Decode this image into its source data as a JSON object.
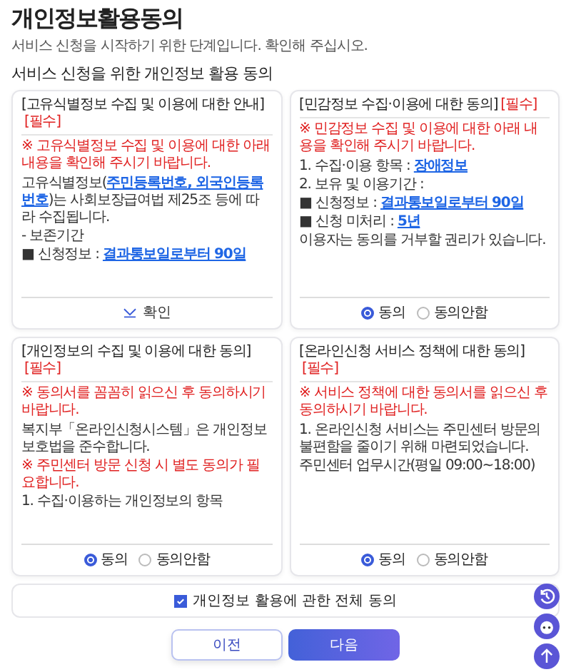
{
  "page": {
    "title": "개인정보활용동의",
    "subtitle": "서비스 신청을 시작하기 위한 단계입니다. 확인해 주십시오."
  },
  "section": {
    "heading": "서비스 신청을 위한 개인정보 활용 동의"
  },
  "cards": [
    {
      "title": "[고유식별정보 수집 및 이용에 대한 안내]",
      "required": "[필수]",
      "notice": "※ 고유식별정보 수집 및 이용에 대한 아래 내용을 확인해 주시기 바랍니다.",
      "lines": [
        {
          "kind": "text",
          "text": "고유식별정보(**주민등록번호, 외국인등록번호**)는 사회보장급여법 제25조 등에 따라 수집됩니다."
        },
        {
          "kind": "text",
          "text": "- 보존기간"
        },
        {
          "kind": "text",
          "text": "■ 신청정보 : **결과통보일로부터 90일**"
        }
      ],
      "footer": {
        "kind": "confirm",
        "label": "확인"
      }
    },
    {
      "title": "[민감정보 수집·이용에 대한 동의]",
      "required": "[필수]",
      "notice": "※ 민감정보 수집 및 이용에 대한 아래 내용을 확인해 주시기 바랍니다.",
      "lines": [
        {
          "kind": "text",
          "text": "1. 수집·이용 항목 : **장애정보**"
        },
        {
          "kind": "text",
          "text": "2. 보유 및 이용기간 :"
        },
        {
          "kind": "text",
          "text": "■ 신청정보 : **결과통보일로부터 90일**"
        },
        {
          "kind": "text",
          "text": "■ 신청 미처리 : **5년**"
        },
        {
          "kind": "text",
          "text": "이용자는 동의를 거부할 권리가 있습니다."
        }
      ],
      "footer": {
        "kind": "radio",
        "options": [
          {
            "label": "동의",
            "selected": true
          },
          {
            "label": "동의안함",
            "selected": false
          }
        ]
      }
    },
    {
      "title": "[개인정보의 수집 및 이용에 대한 동의]",
      "required": "[필수]",
      "notice": "※ 동의서를 꼼꼼히 읽으신 후 동의하시기 바랍니다.",
      "lines": [
        {
          "kind": "text",
          "text": "복지부「온라인신청시스템」은 개인정보보호법을 준수합니다."
        },
        {
          "kind": "warning",
          "text": "※ 주민센터 방문 신청 시 별도 동의가 필요합니다."
        },
        {
          "kind": "text",
          "text": "1. 수집·이용하는 개인정보의 항목"
        }
      ],
      "footer": {
        "kind": "radio",
        "options": [
          {
            "label": "동의",
            "selected": true
          },
          {
            "label": "동의안함",
            "selected": false
          }
        ]
      }
    },
    {
      "title": "[온라인신청 서비스 정책에 대한 동의]",
      "required": "[필수]",
      "notice": "※ 서비스 정책에 대한 동의서를 읽으신 후 동의하시기 바랍니다.",
      "lines": [
        {
          "kind": "text",
          "text": "1. 온라인신청 서비스는 주민센터 방문의 불편함을 줄이기 위해 마련되었습니다."
        },
        {
          "kind": "text",
          "text": "주민센터 업무시간(평일 09:00~18:00)"
        }
      ],
      "footer": {
        "kind": "radio",
        "options": [
          {
            "label": "동의",
            "selected": true
          },
          {
            "label": "동의안함",
            "selected": false
          }
        ]
      }
    }
  ],
  "all_agree": {
    "label": "개인정보 활용에 관한 전체 동의",
    "checked": true
  },
  "buttons": [
    {
      "label": "이전",
      "kind": "secondary"
    },
    {
      "label": "다음",
      "kind": "primary"
    }
  ]
}
